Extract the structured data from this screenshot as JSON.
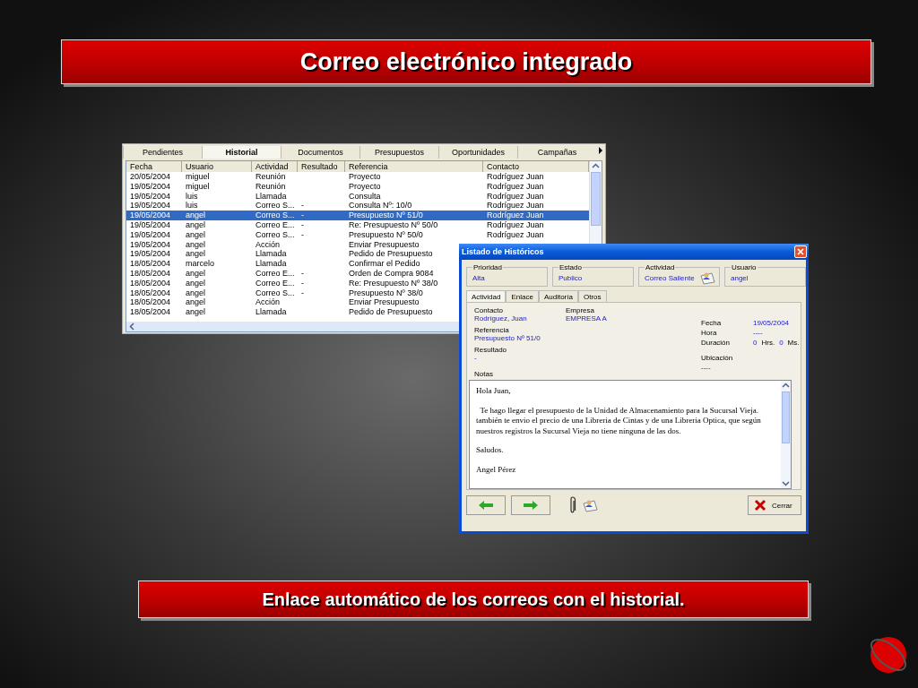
{
  "title": "Correo electrónico integrado",
  "history_window": {
    "tabs": [
      {
        "label": "Pendientes",
        "selected": false
      },
      {
        "label": "Historial",
        "selected": true
      },
      {
        "label": "Documentos",
        "selected": false
      },
      {
        "label": "Presupuestos",
        "selected": false
      },
      {
        "label": "Oportunidades",
        "selected": false
      },
      {
        "label": "Campañas",
        "selected": false
      }
    ],
    "columns": [
      "Fecha",
      "Usuario",
      "Actividad",
      "Resultado",
      "Referencia",
      "Contacto"
    ],
    "rows": [
      {
        "fecha": "20/05/2004",
        "usuario": "miguel",
        "actividad": "Reunión",
        "referencia": "Proyecto",
        "contacto": "Rodríguez Juan",
        "selected": false
      },
      {
        "fecha": "19/05/2004",
        "usuario": "miguel",
        "actividad": "Reunión",
        "referencia": "Proyecto",
        "contacto": "Rodríguez Juan",
        "selected": false
      },
      {
        "fecha": "19/05/2004",
        "usuario": "luis",
        "actividad": "Llamada",
        "referencia": "Consulta",
        "contacto": "Rodríguez Juan",
        "selected": false
      },
      {
        "fecha": "19/05/2004",
        "usuario": "luis",
        "actividad": "Correo S...",
        "resultado": "-",
        "referencia": "Consulta Nº: 10/0",
        "contacto": "Rodríguez Juan",
        "selected": false
      },
      {
        "fecha": "19/05/2004",
        "usuario": "angel",
        "actividad": "Correo S...",
        "resultado": "-",
        "referencia": "Presupuesto Nº 51/0",
        "contacto": "Rodríguez Juan",
        "selected": true
      },
      {
        "fecha": "19/05/2004",
        "usuario": "angel",
        "actividad": "Correo E...",
        "resultado": "-",
        "referencia": "Re: Presupuesto Nº 50/0",
        "contacto": "Rodríguez Juan",
        "selected": false
      },
      {
        "fecha": "19/05/2004",
        "usuario": "angel",
        "actividad": "Correo S...",
        "resultado": "-",
        "referencia": "Presupuesto Nº 50/0",
        "contacto": "Rodríguez Juan",
        "selected": false
      },
      {
        "fecha": "19/05/2004",
        "usuario": "angel",
        "actividad": "Acción",
        "referencia": "Enviar Presupuesto",
        "selected": false
      },
      {
        "fecha": "19/05/2004",
        "usuario": "angel",
        "actividad": "Llamada",
        "referencia": "Pedido de Presupuesto",
        "selected": false
      },
      {
        "fecha": "18/05/2004",
        "usuario": "marcelo",
        "actividad": "Llamada",
        "referencia": "Confirmar el Pedido",
        "selected": false
      },
      {
        "fecha": "18/05/2004",
        "usuario": "angel",
        "actividad": "Correo E...",
        "resultado": "-",
        "referencia": "Orden de Compra 9084",
        "selected": false
      },
      {
        "fecha": "18/05/2004",
        "usuario": "angel",
        "actividad": "Correo E...",
        "resultado": "-",
        "referencia": "Re: Presupuesto Nº 38/0",
        "selected": false
      },
      {
        "fecha": "18/05/2004",
        "usuario": "angel",
        "actividad": "Correo S...",
        "resultado": "-",
        "referencia": "Presupuesto Nº 38/0",
        "selected": false
      },
      {
        "fecha": "18/05/2004",
        "usuario": "angel",
        "actividad": "Acción",
        "referencia": "Enviar Presupuesto",
        "selected": false
      },
      {
        "fecha": "18/05/2004",
        "usuario": "angel",
        "actividad": "Llamada",
        "referencia": "Pedido de Presupuesto",
        "selected": false
      }
    ]
  },
  "dialog": {
    "title": "Listado de Históricos",
    "groups": [
      {
        "label": "Prioridad",
        "value": "Alta"
      },
      {
        "label": "Estado",
        "value": "Publico"
      },
      {
        "label": "Actividad",
        "value": "Correo Saliente"
      },
      {
        "label": "Usuario",
        "value": "angel"
      }
    ],
    "tabs": [
      {
        "label": "Actividad",
        "selected": true
      },
      {
        "label": "Enlace",
        "selected": false
      },
      {
        "label": "Auditoría",
        "selected": false
      },
      {
        "label": "Otros",
        "selected": false
      }
    ],
    "contacto": {
      "label": "Contacto",
      "value": "Rodríguez, Juan"
    },
    "empresa": {
      "label": "Empresa",
      "value": "EMPRESA A"
    },
    "referencia": {
      "label": "Referencia",
      "value": "Presupuesto Nº 51/0"
    },
    "resultado": {
      "label": "Resultado",
      "value": "-"
    },
    "fecha": {
      "label": "Fecha",
      "value": "19/05/2004"
    },
    "hora": {
      "label": "Hora",
      "value": "----"
    },
    "duracion": {
      "label": "Duración",
      "hours": "0",
      "hours_unit": "Hrs.",
      "minutes": "0",
      "minutes_unit": "Ms."
    },
    "ubicacion": {
      "label": "Ubicación",
      "value": "----"
    },
    "notes_label": "Notas",
    "notes": [
      "Hola Juan,",
      "  Te hago llegar el presupuesto de la Unidad de Almacenamiento para la Sucursal Vieja. también te envio el precio de una Libreria de Cintas y de una Libreria Optica, que según nuestros registros la Sucursal Vieja no tiene ninguna de las dos.",
      "Saludos.",
      "Angel Pérez"
    ],
    "close_button": "Cerrar"
  },
  "caption": "Enlace automático de los correos con el historial."
}
